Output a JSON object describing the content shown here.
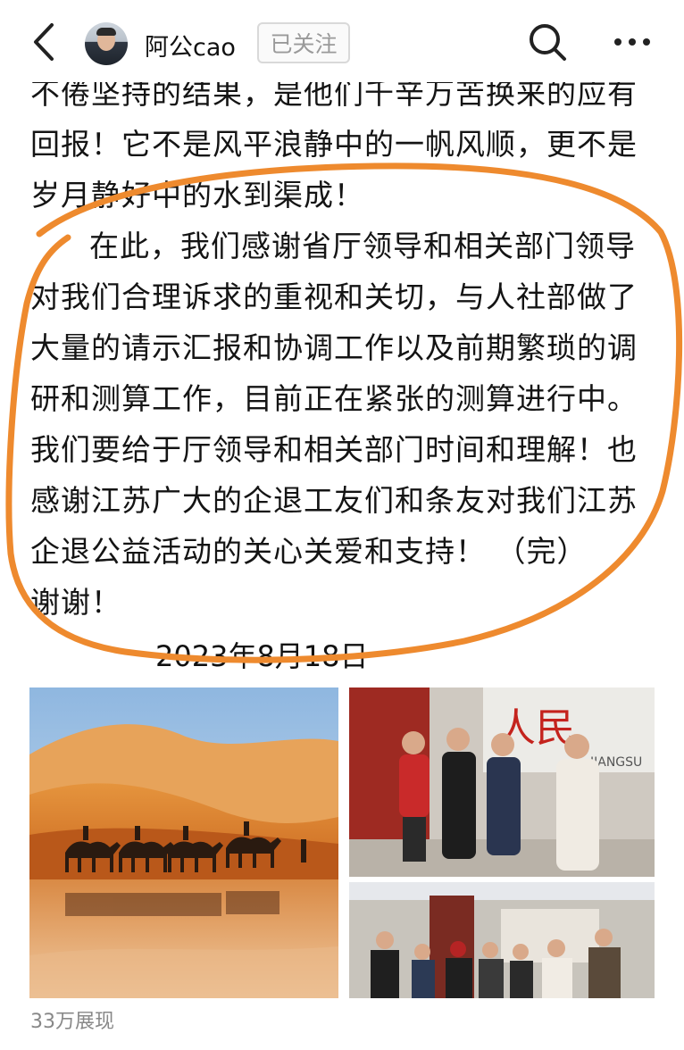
{
  "header": {
    "username": "阿公cao",
    "follow_label": "已关注",
    "icons": [
      "back-arrow-icon",
      "avatar",
      "search-icon",
      "more-icon"
    ]
  },
  "post": {
    "lines": [
      "不倦坚持的结果，是他们千辛万苦换来的应有",
      "回报！它不是风平浪静中的一帆风顺，更不是",
      "岁月静好中的水到渠成！"
    ],
    "paragraph": "在此，我们感谢省厅领导和相关部门领导对我们合理诉求的重视和关切，与人社部做了大量的请示汇报和协调工作以及前期繁琐的调研和测算工作，目前正在紧张的测算进行中。我们要给于厅领导和相关部门时间和理解！也感谢江苏广大的企退工友们和条友对我们江苏企退公益活动的关心关爱和支持！  （完）",
    "thanks": "谢谢！",
    "date": "2023年8月18日"
  },
  "images": {
    "sign_text": "人民",
    "sign_sub": "JIANGSU",
    "annotation_color": "#ee8a2e"
  },
  "footer": {
    "views": "33万展现"
  }
}
